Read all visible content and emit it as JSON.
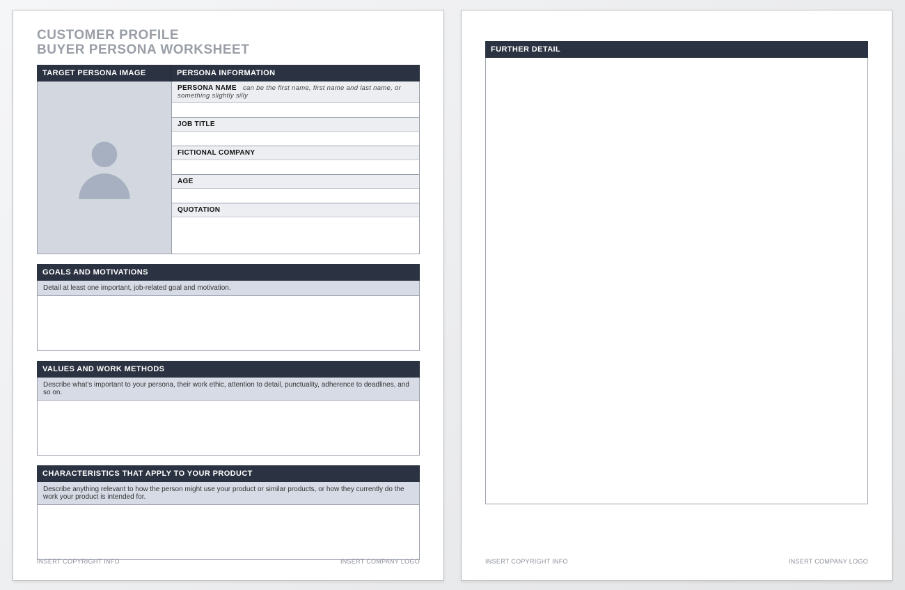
{
  "title": {
    "line1": "CUSTOMER PROFILE",
    "line2": "BUYER PERSONA WORKSHEET"
  },
  "headers": {
    "target_image": "TARGET PERSONA IMAGE",
    "persona_info": "PERSONA INFORMATION",
    "further_detail": "FURTHER DETAIL"
  },
  "fields": {
    "persona_name": {
      "label": "PERSONA NAME",
      "hint": "can be the first name, first name and last name, or something slightly silly",
      "value": ""
    },
    "job_title": {
      "label": "JOB TITLE",
      "value": ""
    },
    "company": {
      "label": "FICTIONAL COMPANY",
      "value": ""
    },
    "age": {
      "label": "AGE",
      "value": ""
    },
    "quotation": {
      "label": "QUOTATION",
      "value": ""
    }
  },
  "sections": {
    "goals": {
      "header": "GOALS AND MOTIVATIONS",
      "hint": "Detail at least one important, job-related goal and motivation.",
      "value": ""
    },
    "values": {
      "header": "VALUES AND WORK METHODS",
      "hint": "Describe what's important to your persona, their work ethic, attention to detail, punctuality, adherence to deadlines, and so on.",
      "value": ""
    },
    "chars": {
      "header": "CHARACTERISTICS THAT APPLY TO YOUR PRODUCT",
      "hint": "Describe anything relevant to how the person might use your product or similar products, or how they currently do the work your product is intended for.",
      "value": ""
    }
  },
  "footer": {
    "copyright": "INSERT COPYRIGHT INFO",
    "logo": "INSERT COMPANY LOGO"
  }
}
